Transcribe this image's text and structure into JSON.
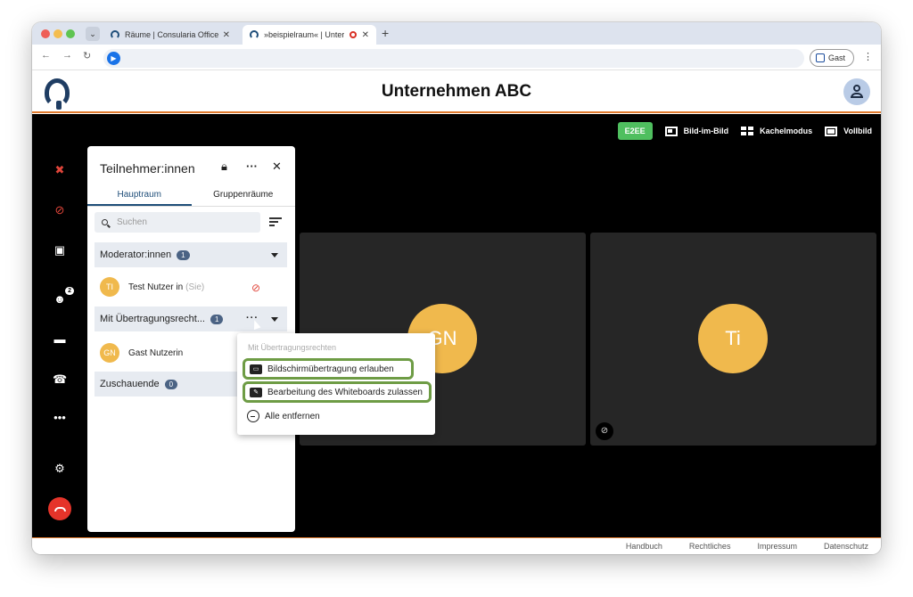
{
  "browser": {
    "tabs": [
      {
        "title": "Räume | Consularia Office"
      },
      {
        "title": "»beispielraum« | Unternehmen"
      }
    ],
    "guest_label": "Gast"
  },
  "app": {
    "title": "Unternehmen ABC"
  },
  "toolbar": {
    "e2ee": "E2EE",
    "pip": "Bild-im-Bild",
    "tile": "Kachelmodus",
    "fullscreen": "Vollbild"
  },
  "sidebar": {
    "participants_count": "2"
  },
  "panel": {
    "title": "Teilnehmer:innen",
    "tabs": [
      "Hauptraum",
      "Gruppenräume"
    ],
    "search_placeholder": "Suchen",
    "groups": [
      {
        "label": "Moderator:innen",
        "count": "1"
      },
      {
        "label": "Mit Übertragungsrecht...",
        "count": "1"
      },
      {
        "label": "Zuschauende",
        "count": "0"
      }
    ],
    "users": [
      {
        "initials": "TI",
        "name": "Test Nutzer in",
        "suffix": "(Sie)"
      },
      {
        "initials": "GN",
        "name": "Gast Nutzerin"
      }
    ]
  },
  "videos": [
    {
      "initials": "GN"
    },
    {
      "initials": "Ti"
    }
  ],
  "menu": {
    "header": "Mit Übertragungsrechten",
    "items": [
      "Bildschirmübertragung erlauben",
      "Bearbeitung des Whiteboards zulassen",
      "Alle entfernen"
    ]
  },
  "footer": {
    "links": [
      "Handbuch",
      "Rechtliches",
      "Impressum",
      "Datenschutz"
    ]
  },
  "colors": {
    "accent": "#e07a2d",
    "e2ee": "#4fbf5f",
    "avatar": "#f0b94d",
    "highlight": "#6e9c45",
    "danger": "#e5342a"
  }
}
